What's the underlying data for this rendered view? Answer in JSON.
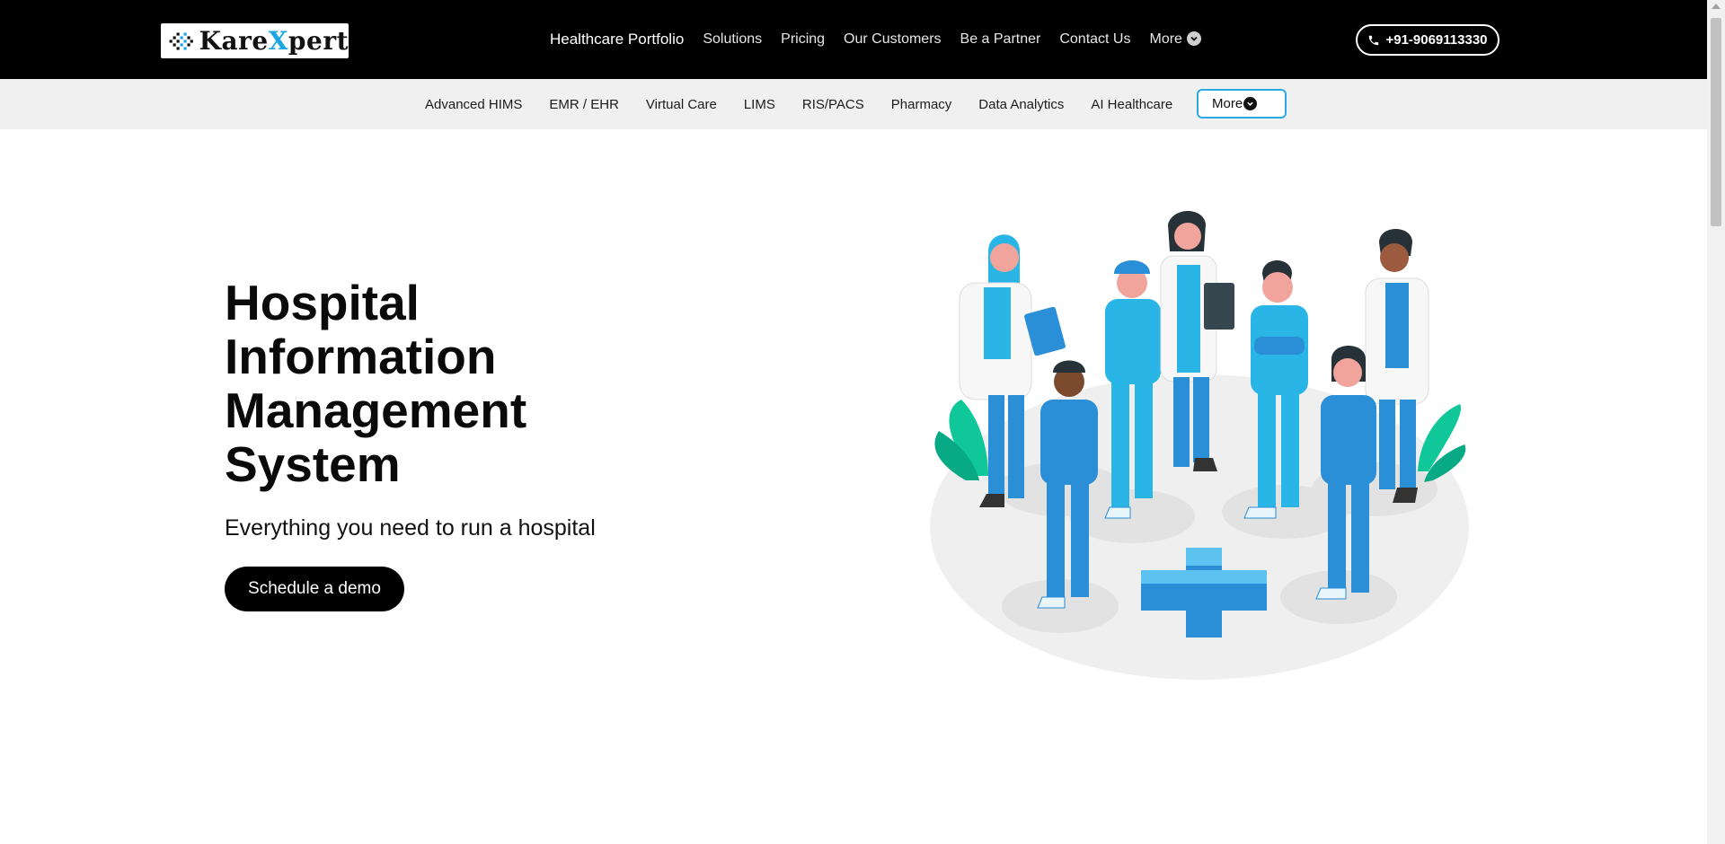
{
  "header": {
    "logo_text_a": "Kare",
    "logo_text_x": "X",
    "logo_text_b": "pert",
    "nav": [
      {
        "label": "Healthcare Portfolio"
      },
      {
        "label": "Solutions"
      },
      {
        "label": "Pricing"
      },
      {
        "label": "Our Customers"
      },
      {
        "label": "Be a Partner"
      },
      {
        "label": "Contact Us"
      },
      {
        "label": "More"
      }
    ],
    "phone": "+91-9069113330"
  },
  "subnav": {
    "items": [
      {
        "label": "Advanced HIMS"
      },
      {
        "label": "EMR / EHR"
      },
      {
        "label": "Virtual Care"
      },
      {
        "label": "LIMS"
      },
      {
        "label": "RIS/PACS"
      },
      {
        "label": "Pharmacy"
      },
      {
        "label": "Data Analytics"
      },
      {
        "label": "AI Healthcare"
      }
    ],
    "more_label": "More"
  },
  "hero": {
    "title_lines": [
      "Hospital",
      "Information",
      "Management",
      "System"
    ],
    "subtitle": "Everything you need to run a hospital",
    "cta": "Schedule a demo"
  },
  "colors": {
    "header_bg": "#000000",
    "subnav_bg": "#f0f0f0",
    "accent": "#2aa8e6",
    "scrub_blue": "#2a8fd6",
    "scrub_light": "#29b6e6"
  },
  "icons": {
    "phone": "phone-icon",
    "nav_more": "chevron-down-icon",
    "subnav_more": "chevron-down-icon"
  }
}
